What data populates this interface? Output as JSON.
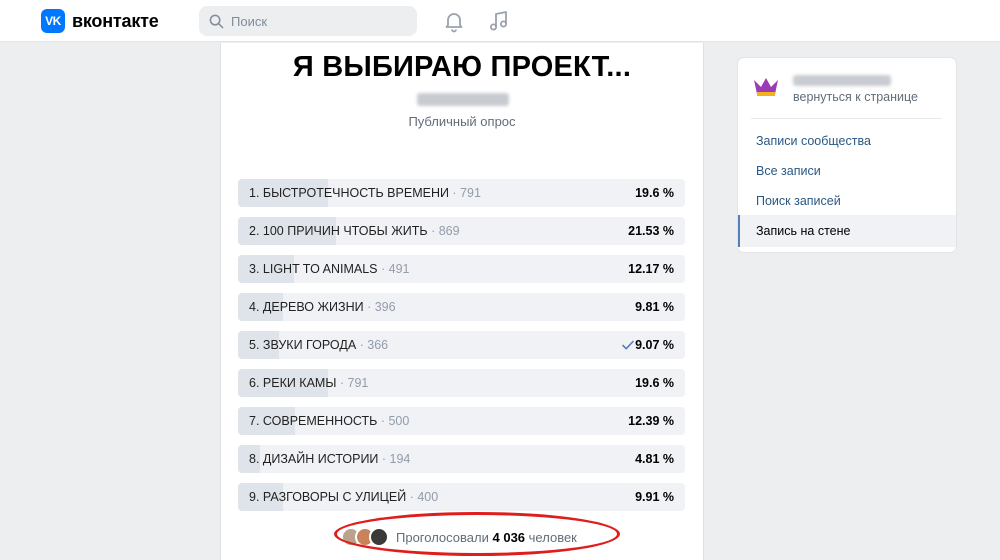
{
  "header": {
    "logo_mark": "VK",
    "logo_text": "вконтакте",
    "search_placeholder": "Поиск"
  },
  "poll": {
    "title": "Я ВЫБИРАЮ ПРОЕКТ...",
    "kind": "Публичный опрос",
    "options": [
      {
        "label": "1. БЫСТРОТЕЧНОСТЬ ВРЕМЕНИ",
        "count": " · 791",
        "percent": "19.6 %",
        "share": 0.196
      },
      {
        "label": "2. 100 ПРИЧИН ЧТОБЫ ЖИТЬ",
        "count": " · 869",
        "percent": "21.53 %",
        "share": 0.2153
      },
      {
        "label": "3. LIGHT TO ANIMALS",
        "count": " · 491",
        "percent": "12.17 %",
        "share": 0.1217
      },
      {
        "label": "4. ДЕРЕВО ЖИЗНИ",
        "count": " · 396",
        "percent": "9.81 %",
        "share": 0.0981
      },
      {
        "label": "5. ЗВУКИ ГОРОДА",
        "count": " · 366",
        "percent": "9.07 %",
        "share": 0.0907,
        "voted": true
      },
      {
        "label": "6. РЕКИ КАМЫ",
        "count": " · 791",
        "percent": "19.6 %",
        "share": 0.196
      },
      {
        "label": "7. СОВРЕМЕННОСТЬ",
        "count": " · 500",
        "percent": "12.39 %",
        "share": 0.1239
      },
      {
        "label": "8. ДИЗАЙН ИСТОРИИ",
        "count": " · 194",
        "percent": "4.81 %",
        "share": 0.0481
      },
      {
        "label": "9. РАЗГОВОРЫ С УЛИЦЕЙ",
        "count": " · 400",
        "percent": "9.91 %",
        "share": 0.0991
      }
    ],
    "voters_prefix": "Проголосовали ",
    "voters_count": "4 036",
    "voters_suffix": " человек"
  },
  "sidebar": {
    "back_link": "вернуться к странице",
    "links": [
      "Записи сообщества",
      "Все записи",
      "Поиск записей",
      "Запись на стене"
    ],
    "active_index": 3
  },
  "colors": {
    "brand": "#0077ff",
    "accent_link": "#2a5885",
    "highlight": "#e01d1d"
  }
}
